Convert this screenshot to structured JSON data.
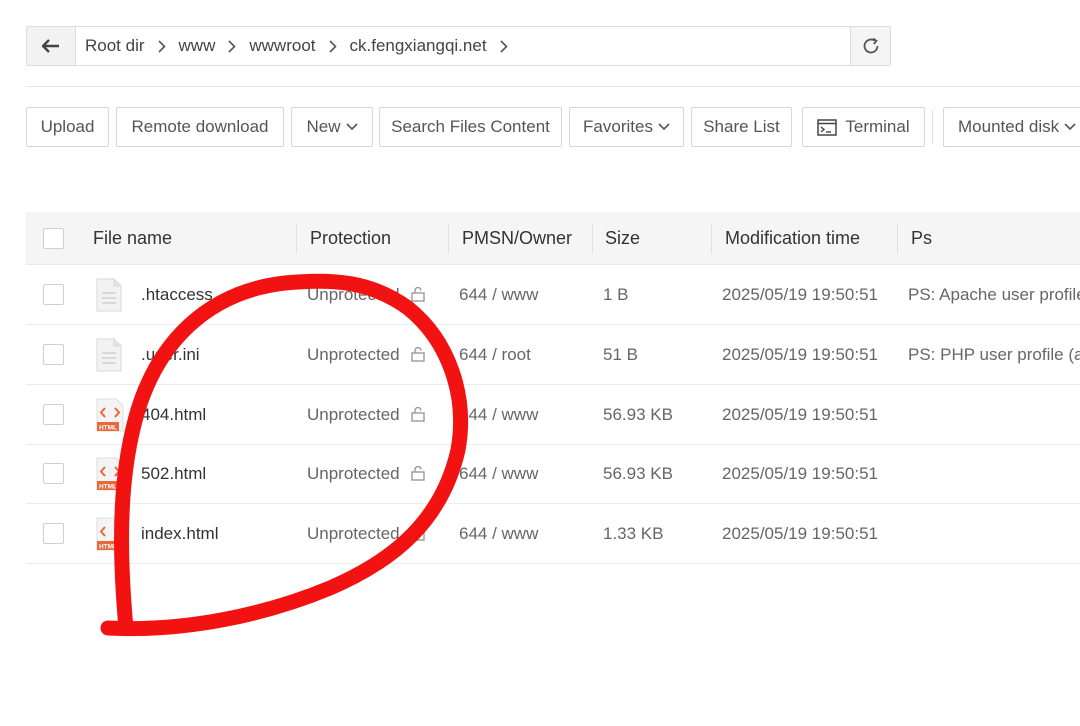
{
  "pathbar": {
    "crumbs": [
      "Root dir",
      "www",
      "wwwroot",
      "ck.fengxiangqi.net"
    ]
  },
  "toolbar": {
    "upload": "Upload",
    "remote_download": "Remote download",
    "new": "New",
    "search_files_content": "Search Files Content",
    "favorites": "Favorites",
    "share_list": "Share List",
    "terminal": "Terminal",
    "mounted_disk": "Mounted disk"
  },
  "table": {
    "headers": {
      "file_name": "File name",
      "protection": "Protection",
      "pmsn_owner": "PMSN/Owner",
      "size": "Size",
      "modification_time": "Modification time",
      "ps": "Ps"
    },
    "rows": [
      {
        "name": ".htaccess",
        "icon": "text-file-icon",
        "protection": "Unprotected",
        "pmsn": "644 / www",
        "size": "1 B",
        "mtime": "2025/05/19 19:50:51",
        "ps": "PS: Apache user profile"
      },
      {
        "name": ".user.ini",
        "icon": "text-file-icon",
        "protection": "Unprotected",
        "pmsn": "644 / root",
        "size": "51 B",
        "mtime": "2025/05/19 19:50:51",
        "ps": "PS: PHP user profile (a"
      },
      {
        "name": "404.html",
        "icon": "html-file-icon",
        "protection": "Unprotected",
        "pmsn": "644 / www",
        "size": "56.93 KB",
        "mtime": "2025/05/19 19:50:51",
        "ps": ""
      },
      {
        "name": "502.html",
        "icon": "html-file-icon",
        "protection": "Unprotected",
        "pmsn": "644 / www",
        "size": "56.93 KB",
        "mtime": "2025/05/19 19:50:51",
        "ps": ""
      },
      {
        "name": "index.html",
        "icon": "html-file-icon",
        "protection": "Unprotected",
        "pmsn": "644 / www",
        "size": "1.33 KB",
        "mtime": "2025/05/19 19:50:51",
        "ps": ""
      }
    ]
  },
  "html_icon_label": "HTML",
  "colors": {
    "annotation_red": "#f21212",
    "html_icon_orange": "#e8683a"
  }
}
